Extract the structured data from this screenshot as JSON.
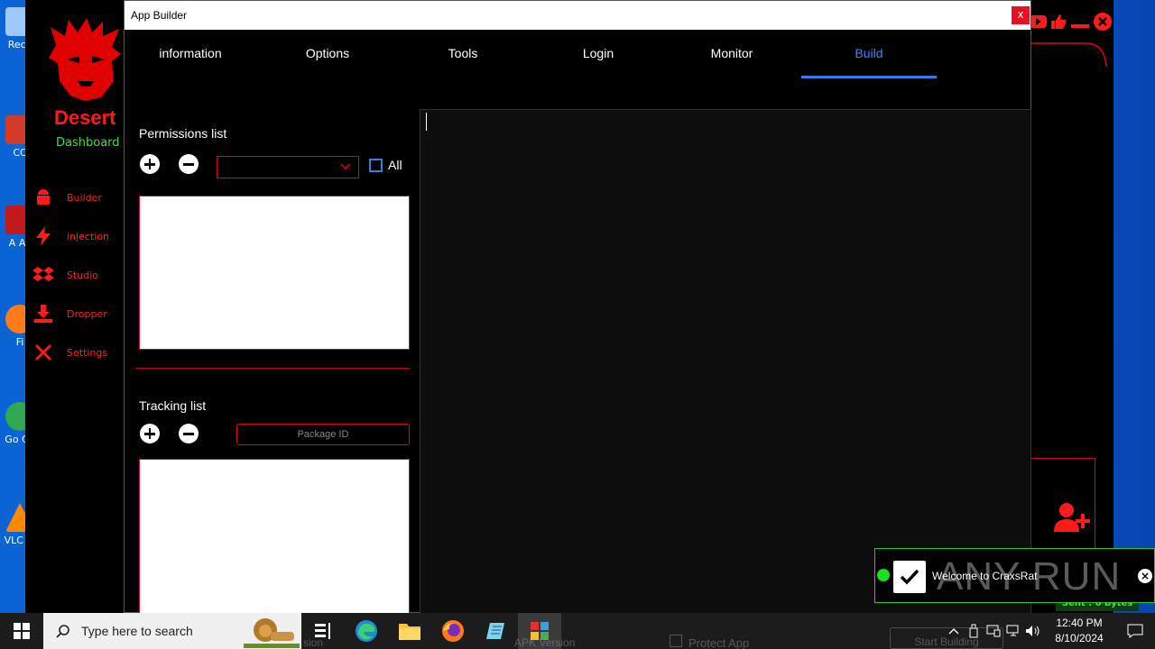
{
  "desktop": {
    "icons": [
      {
        "label": "Recy",
        "color": "#9ec9ff"
      },
      {
        "label": "CC",
        "color": "#d23a2a"
      },
      {
        "label": "A Ac",
        "color": "#c21a1a"
      },
      {
        "label": "Fi",
        "color": "#ff7b1a"
      },
      {
        "label": "Go Ch",
        "color": "#2fa84f"
      },
      {
        "label": "VLC pl",
        "color": "#ff8800"
      }
    ]
  },
  "bg_app": {
    "brand": "Desert",
    "subtitle": "Dashboard",
    "menu": [
      {
        "label": "Builder",
        "icon": "android-icon"
      },
      {
        "label": "injection",
        "icon": "bolt-icon"
      },
      {
        "label": "Studio",
        "icon": "dropbox-icon"
      },
      {
        "label": "Dropper",
        "icon": "download-icon"
      },
      {
        "label": "Settings",
        "icon": "tools-icon"
      }
    ],
    "sent_bytes": "Sent : 0 bytes",
    "accent": "#ff1a1a"
  },
  "window": {
    "title": "App Builder",
    "close_label": "x",
    "tabs": [
      {
        "label": "information"
      },
      {
        "label": "Options"
      },
      {
        "label": "Tools"
      },
      {
        "label": "Login"
      },
      {
        "label": "Monitor"
      },
      {
        "label": "Build"
      }
    ],
    "active_tab": "Build",
    "permissions": {
      "label": "Permissions list",
      "select_value": "",
      "all_label": "All"
    },
    "tracking": {
      "label": "Tracking list",
      "package_placeholder": "Package ID"
    }
  },
  "toast": {
    "message": "Welcome to CraxsRat",
    "watermark": "ANY RUN"
  },
  "taskbar": {
    "search_placeholder": "Type here to search",
    "time": "12:40 PM",
    "date": "8/10/2024",
    "ghost": {
      "left": "sion",
      "middle": "APK Version",
      "protect": "Protect App",
      "start": "Start Building"
    }
  }
}
